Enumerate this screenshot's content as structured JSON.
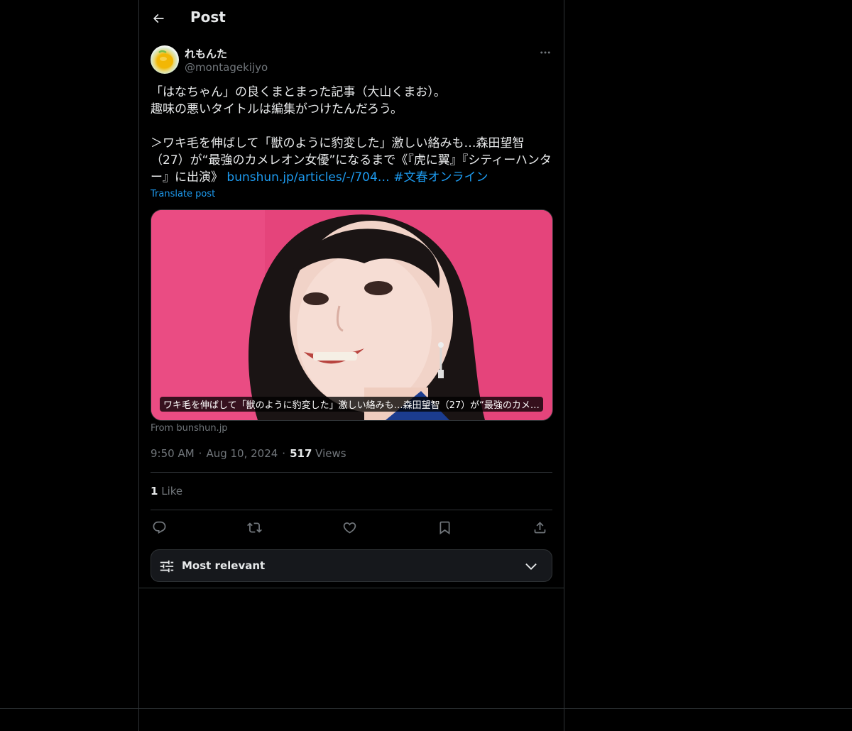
{
  "header": {
    "title": "Post"
  },
  "author": {
    "display_name": "れもんた",
    "handle": "@montagekijyo"
  },
  "tweet": {
    "text": "「はなちゃん」の良くまとまった記事（大山くまお）。\n趣味の悪いタイトルは編集がつけたんだろう。\n\n＞ワキ毛を伸ばして「獣のように豹変した」激しい絡みも…森田望智（27）が“最強のカメレオン女優”になるまで《『虎に翼』『シティーハンター』に出演》 ",
    "link_text": "bunshun.jp/articles/-/704…",
    "hashtag": "#文春オンライン",
    "translate_label": "Translate post"
  },
  "card": {
    "caption": "ワキ毛を伸ばして「獣のように豹変した」激しい絡みも…森田望智（27）が“最強のカメ…",
    "source": "From bunshun.jp"
  },
  "meta": {
    "time": "9:50 AM",
    "date": "Aug 10, 2024",
    "separator": "·",
    "views_count": "517",
    "views_label": "Views"
  },
  "engagement": {
    "likes_count": "1",
    "likes_label": "Like"
  },
  "sort": {
    "label": "Most relevant"
  },
  "icons": {
    "back": "arrow-left-icon",
    "more": "more-horizontal-icon",
    "reply": "reply-icon",
    "retweet": "retweet-icon",
    "like": "heart-icon",
    "bookmark": "bookmark-icon",
    "share": "share-icon",
    "sort": "sliders-icon",
    "chevron": "chevron-down-icon"
  },
  "colors": {
    "background": "#000000",
    "text": "#e7e9ea",
    "muted": "#71767b",
    "accent": "#1d9bf0",
    "border": "#2f3336"
  }
}
